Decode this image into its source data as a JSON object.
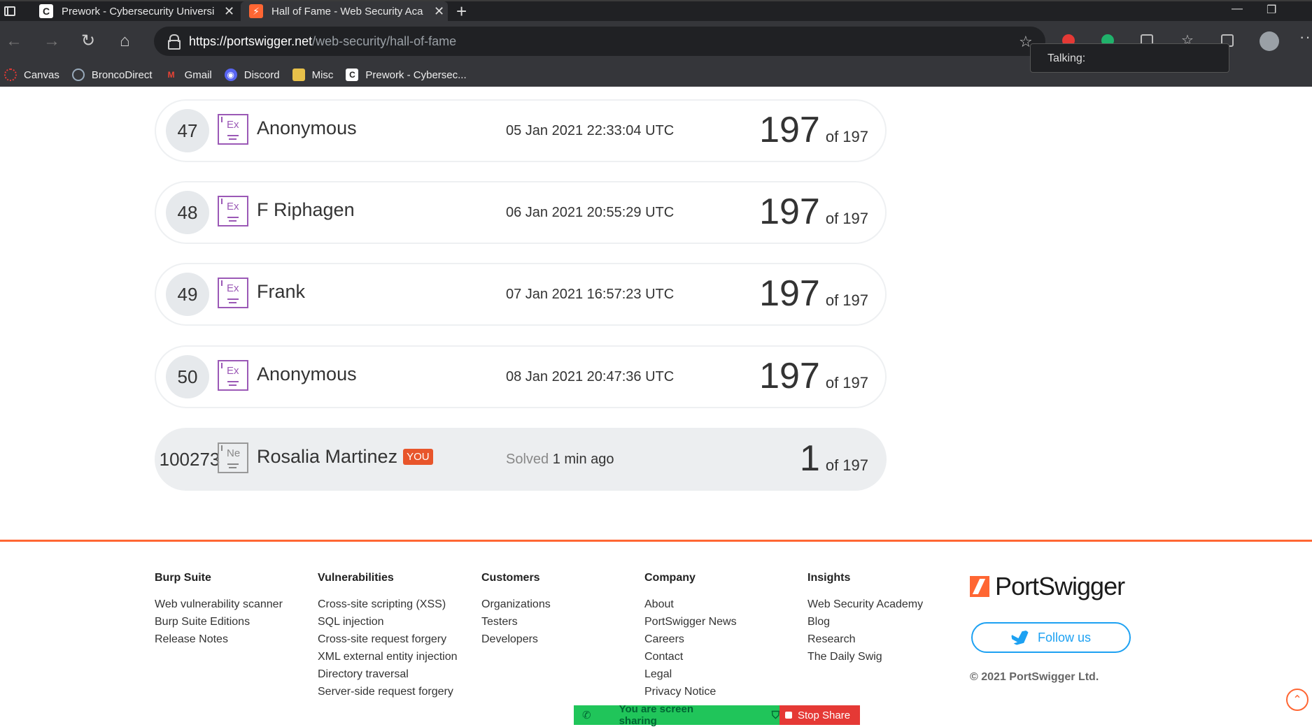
{
  "browser": {
    "tabs": [
      {
        "title": "Prework - Cybersecurity Universi",
        "favicon": "C",
        "active": false
      },
      {
        "title": "Hall of Fame - Web Security Aca",
        "favicon": "PS",
        "active": true
      }
    ],
    "url_host": "https://portswigger.net",
    "url_path": "/web-security/hall-of-fame",
    "bookmarks": [
      "Canvas",
      "BroncoDirect",
      "Gmail",
      "Discord",
      "Misc",
      "Prework - Cybersec..."
    ],
    "popup_text": "Talking:"
  },
  "leaderboard": [
    {
      "rank": "47",
      "level": "Ex",
      "name": "Anonymous",
      "date": "05 Jan 2021 22:33:04 UTC",
      "solved": "197",
      "total": "of 197"
    },
    {
      "rank": "48",
      "level": "Ex",
      "name": "F Riphagen",
      "date": "06 Jan 2021 20:55:29 UTC",
      "solved": "197",
      "total": "of 197"
    },
    {
      "rank": "49",
      "level": "Ex",
      "name": "Frank",
      "date": "07 Jan 2021 16:57:23 UTC",
      "solved": "197",
      "total": "of 197"
    },
    {
      "rank": "50",
      "level": "Ex",
      "name": "Anonymous",
      "date": "08 Jan 2021 20:47:36 UTC",
      "solved": "197",
      "total": "of 197"
    }
  ],
  "current_user": {
    "rank": "100273",
    "level": "Ne",
    "name": "Rosalia Martinez",
    "tag": "YOU",
    "solved_prefix": "Solved",
    "solved_time": "1 min ago",
    "solved": "1",
    "total": "of 197"
  },
  "footer": {
    "columns": [
      {
        "heading": "Burp Suite",
        "links": [
          "Web vulnerability scanner",
          "Burp Suite Editions",
          "Release Notes"
        ]
      },
      {
        "heading": "Vulnerabilities",
        "links": [
          "Cross-site scripting (XSS)",
          "SQL injection",
          "Cross-site request forgery",
          "XML external entity injection",
          "Directory traversal",
          "Server-side request forgery"
        ]
      },
      {
        "heading": "Customers",
        "links": [
          "Organizations",
          "Testers",
          "Developers"
        ]
      },
      {
        "heading": "Company",
        "links": [
          "About",
          "PortSwigger News",
          "Careers",
          "Contact",
          "Legal",
          "Privacy Notice"
        ]
      },
      {
        "heading": "Insights",
        "links": [
          "Web Security Academy",
          "Blog",
          "Research",
          "The Daily Swig"
        ]
      }
    ],
    "brand": "PortSwigger",
    "follow_label": "Follow us",
    "copyright": "© 2021 PortSwigger Ltd."
  },
  "screen_share": {
    "status": "You are screen sharing",
    "stop_label": "Stop Share"
  },
  "colors": {
    "accent": "#ff6633",
    "expert_badge": "#9b59b6",
    "twitter": "#1da1f2"
  }
}
